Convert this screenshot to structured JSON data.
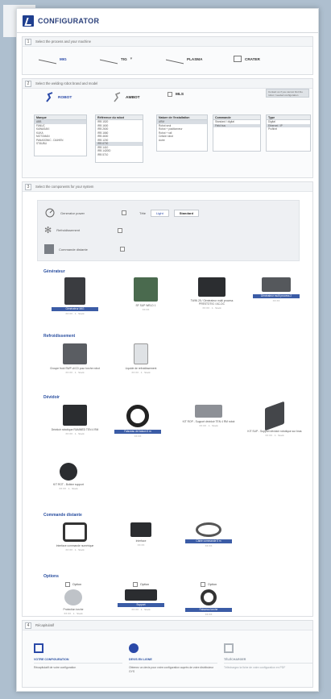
{
  "app": {
    "title": "CONFIGURATOR"
  },
  "section1": {
    "number": "1",
    "title": "Select the process and your machine",
    "processes": [
      {
        "label": "MIG",
        "selected": true
      },
      {
        "label": "TIG",
        "caret": "▾"
      },
      {
        "label": "PLASMA"
      },
      {
        "label": "CRATER"
      }
    ]
  },
  "section2": {
    "number": "2",
    "title": "Select the welding robot brand and model",
    "robots": [
      {
        "label": "ROBOT",
        "selected": true
      },
      {
        "label": "AMBOT"
      },
      {
        "label": "MLS"
      }
    ],
    "side_button": "Contact us if you cannot find the robot / needed configuration",
    "columns": [
      {
        "header": "Marque",
        "items": [
          "ABB",
          "FANUC",
          "KAWASAKI",
          "KUKA",
          "MOTOMAN",
          "PANASONIC - DAIHEN",
          "STÄUBLI"
        ],
        "selected": 0
      },
      {
        "header": "Référence du robot",
        "items": [
          "IRB 1520",
          "IRB 1600",
          "IRB 2600",
          "IRB 1660",
          "IRB 4600",
          "IRB 1200",
          "IRB 6700",
          "IRB 1410",
          "IRB 1420ID",
          "IRB 5710"
        ],
        "selected": 6
      },
      {
        "header": "Nature de l'installation",
        "items": [
          "ARM",
          "Robot seul",
          "Robot + positionneur",
          "Robot + rail",
          "Cellule robot",
          "Autre"
        ],
        "selected": 0
      },
      {
        "header": "Commande",
        "items": [
          "Standard / digital",
          "Field bus"
        ],
        "selected": 1
      },
      {
        "header": "Type",
        "items": [
          "Digital",
          "Ethernet / IP",
          "Profinet"
        ],
        "selected": 1
      }
    ]
  },
  "section3": {
    "number": "3",
    "title": "Select the components for your system",
    "options": [
      {
        "label": "Generator power",
        "value_label": "Tête",
        "buttons": [
          "Light",
          "Standard"
        ]
      },
      {
        "label": "Refroidissement"
      },
      {
        "label": "Commande distante"
      }
    ]
  },
  "groups": [
    {
      "title": "Générateur",
      "items": [
        {
          "caption": "Générateur MIG",
          "sub": "XX XX · 1 · Stock",
          "selected": true
        },
        {
          "caption": "SF SUP WELD 1",
          "sub": "XX XX",
          "selected": false
        },
        {
          "caption": "TWIN 25 / Générateur multi process PRESTOTIG / AC-DC",
          "sub": "XX XX · 1 · Stock",
          "selected": false
        },
        {
          "caption": "Générateur multi process 2",
          "sub": "XX XX",
          "selected": true
        }
      ]
    },
    {
      "title": "Refroidissement",
      "items": [
        {
          "caption": "Groupe froid SWP-A/CD pour torche robot",
          "sub": "XX XX · 1 · Stock",
          "selected": false
        },
        {
          "caption": "Liquide de refroidissement",
          "sub": "XX XX · 1 · Stock",
          "selected": false
        }
      ]
    },
    {
      "title": "Dévidoir",
      "items": [
        {
          "caption": "Dévidoir robotique RAMMED TEN 4 RM",
          "sub": "XX XX · 1 · Stock",
          "selected": false
        },
        {
          "caption": "Faisceau de liaison 5 m",
          "sub": "XX XX",
          "selected": true
        },
        {
          "caption": "KIT ROP - Support dévidoir TEN 4 RM robot",
          "sub": "XX XX · 1 · Stock",
          "selected": false
        },
        {
          "caption": "KIT SUP - Support dévidoir robotique sur bras",
          "sub": "XX XX · 1 · Stock",
          "selected": false
        },
        {
          "caption": "KIT ROT - Bobine support",
          "sub": "XX XX · 1 · Stock",
          "selected": false
        }
      ]
    },
    {
      "title": "Commande distante",
      "items": [
        {
          "caption": "Interface commande numérique",
          "sub": "XX XX · 1 · Stock",
          "selected": false
        },
        {
          "caption": "Interface",
          "sub": "XX XX",
          "selected": false
        },
        {
          "caption": "Câble commande 5 m",
          "sub": "XX XX",
          "selected": true
        }
      ]
    },
    {
      "title": "Options",
      "items": [
        {
          "caption": "Protection torche",
          "sub": "XX XX · 1 · Stock",
          "selected": false,
          "check": "Option"
        },
        {
          "caption": "Support",
          "sub": "XX XX · 1 · Stock",
          "selected": true,
          "check": "Option"
        },
        {
          "caption": "Faisceau torche",
          "sub": "XX XX",
          "selected": true,
          "check": "Option"
        }
      ]
    }
  ],
  "footer": {
    "number": "4",
    "title": "Récapitulatif",
    "cols": [
      {
        "title": "VOTRE CONFIGURATION",
        "text": "Récapitulatif de votre configuration"
      },
      {
        "title": "DEVIS EN LIGNE",
        "text": "Obtenez un devis pour votre configuration auprès de votre distributeur GYS"
      },
      {
        "title": "TÉLÉCHARGER",
        "text": "Téléchargez la fiche de votre configuration en PDF"
      }
    ]
  },
  "colors": {
    "accent": "#2a49a8",
    "brand": "#1f3f8f",
    "selection": "#3b5ca6"
  }
}
